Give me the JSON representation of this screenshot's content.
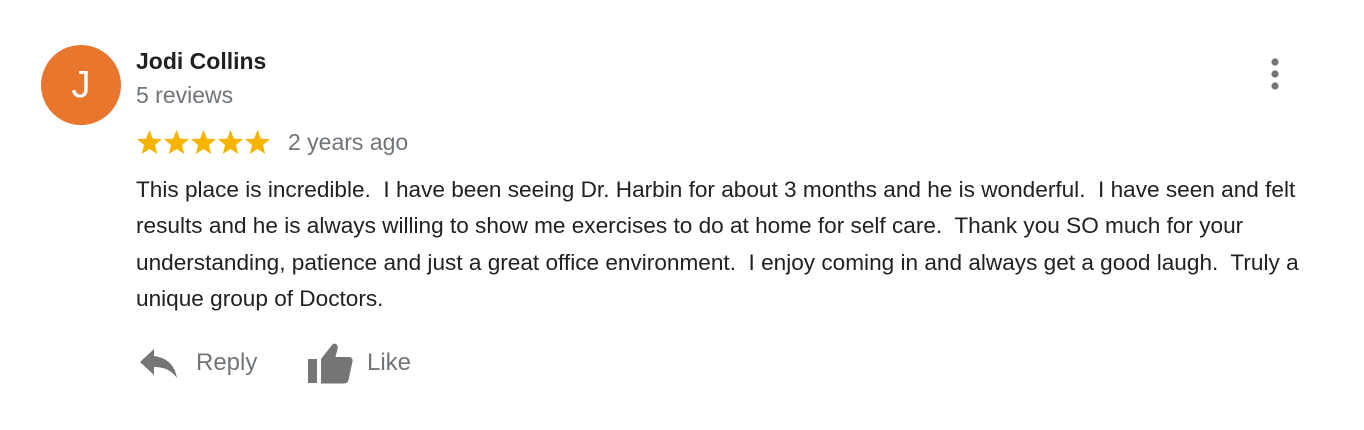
{
  "review": {
    "author": {
      "initial": "J",
      "name": "Jodi Collins",
      "reviews_count": "5 reviews",
      "avatar_color": "#e8762d"
    },
    "rating": 5,
    "rating_max": 5,
    "star_color": "#f4b400",
    "date": "2 years ago",
    "text": "This place is incredible.  I have been seeing Dr. Harbin for about 3 months and he is wonderful.  I have seen and felt results and he is always willing to show me exercises to do at home for self care.  Thank you SO much for your understanding, patience and just a great office environment.  I enjoy coming in and always get a good laugh.  Truly a unique group of Doctors."
  },
  "actions": {
    "reply": {
      "label": "Reply",
      "icon": "reply-arrow-icon"
    },
    "like": {
      "label": "Like",
      "icon": "thumbs-up-icon"
    }
  },
  "menu": {
    "icon": "more-vert-icon"
  },
  "colors": {
    "text_primary": "#202124",
    "text_secondary": "#70757a",
    "icon_gray": "#757575"
  }
}
